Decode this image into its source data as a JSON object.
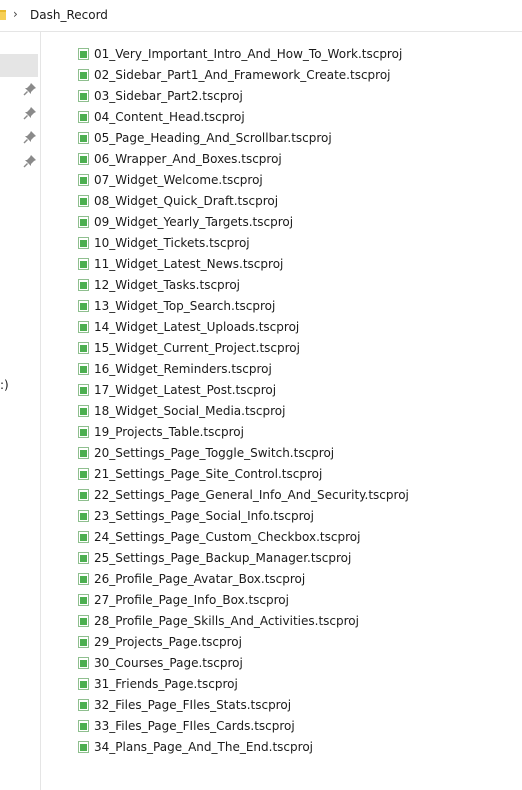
{
  "breadcrumb": {
    "icon": "folder-icon",
    "chevron_icon": "chevron-right-icon",
    "path": "Dash_Record"
  },
  "nav": {
    "pin_icon": "pin-icon",
    "partial_label": ":)"
  },
  "colors": {
    "file_icon": "#4caf50",
    "folder_icon": "#e8b92c",
    "selection": "#e5e5e5"
  },
  "files": [
    {
      "name": "01_Very_Important_Intro_And_How_To_Work.tscproj"
    },
    {
      "name": "02_Sidebar_Part1_And_Framework_Create.tscproj"
    },
    {
      "name": "03_Sidebar_Part2.tscproj"
    },
    {
      "name": "04_Content_Head.tscproj"
    },
    {
      "name": "05_Page_Heading_And_Scrollbar.tscproj"
    },
    {
      "name": "06_Wrapper_And_Boxes.tscproj"
    },
    {
      "name": "07_Widget_Welcome.tscproj"
    },
    {
      "name": "08_Widget_Quick_Draft.tscproj"
    },
    {
      "name": "09_Widget_Yearly_Targets.tscproj"
    },
    {
      "name": "10_Widget_Tickets.tscproj"
    },
    {
      "name": "11_Widget_Latest_News.tscproj"
    },
    {
      "name": "12_Widget_Tasks.tscproj"
    },
    {
      "name": "13_Widget_Top_Search.tscproj"
    },
    {
      "name": "14_Widget_Latest_Uploads.tscproj"
    },
    {
      "name": "15_Widget_Current_Project.tscproj"
    },
    {
      "name": "16_Widget_Reminders.tscproj"
    },
    {
      "name": "17_Widget_Latest_Post.tscproj"
    },
    {
      "name": "18_Widget_Social_Media.tscproj"
    },
    {
      "name": "19_Projects_Table.tscproj"
    },
    {
      "name": "20_Settings_Page_Toggle_Switch.tscproj"
    },
    {
      "name": "21_Settings_Page_Site_Control.tscproj"
    },
    {
      "name": "22_Settings_Page_General_Info_And_Security.tscproj"
    },
    {
      "name": "23_Settings_Page_Social_Info.tscproj"
    },
    {
      "name": "24_Settings_Page_Custom_Checkbox.tscproj"
    },
    {
      "name": "25_Settings_Page_Backup_Manager.tscproj"
    },
    {
      "name": "26_Profile_Page_Avatar_Box.tscproj"
    },
    {
      "name": "27_Profile_Page_Info_Box.tscproj"
    },
    {
      "name": "28_Profile_Page_Skills_And_Activities.tscproj"
    },
    {
      "name": "29_Projects_Page.tscproj"
    },
    {
      "name": "30_Courses_Page.tscproj"
    },
    {
      "name": "31_Friends_Page.tscproj"
    },
    {
      "name": "32_Files_Page_FIles_Stats.tscproj"
    },
    {
      "name": "33_Files_Page_FIles_Cards.tscproj"
    },
    {
      "name": "34_Plans_Page_And_The_End.tscproj"
    }
  ]
}
